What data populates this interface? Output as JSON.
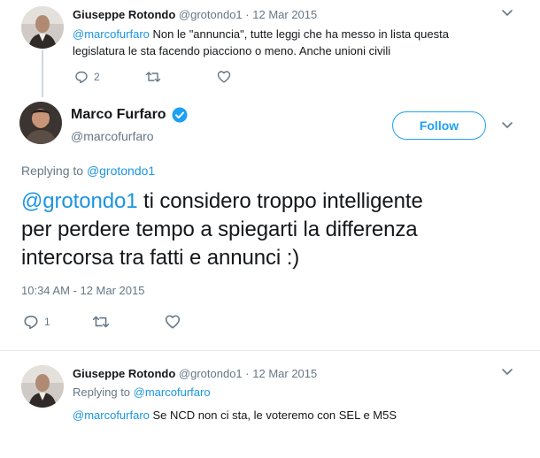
{
  "tweet1": {
    "name": "Giuseppe Rotondo",
    "handle": "@grotondo1",
    "sep": "·",
    "date": "12 Mar 2015",
    "mention": "@marcofurfaro",
    "text_line1": " Non le \"annuncia\", tutte leggi che ha messo in lista questa",
    "text_line2": "legislatura le sta facendo piacciono o meno. Anche unioni civili",
    "reply_count": "2",
    "avatar_icon": "avatar-photo",
    "caret_icon": "chevron-down-icon"
  },
  "main": {
    "name": "Marco Furfaro",
    "handle": "@marcofurfaro",
    "verified_icon": "verified-badge-icon",
    "follow_label": "Follow",
    "replying_prefix": "Replying to ",
    "replying_handle": "@grotondo1",
    "mention": "@grotondo1",
    "text_line1": " ti considero troppo intelligente",
    "text_line2": "per perdere tempo a spiegarti la differenza",
    "text_line3": "intercorsa tra fatti e annunci :)",
    "timestamp": "10:34 AM - 12 Mar 2015",
    "reply_count": "1"
  },
  "tweet3": {
    "name": "Giuseppe Rotondo",
    "handle": "@grotondo1",
    "sep": "·",
    "date": "12 Mar 2015",
    "replying_prefix": "Replying to ",
    "replying_handle": "@marcofurfaro",
    "mention": "@marcofurfaro",
    "text": " Se NCD non ci sta, le voteremo con SEL e M5S"
  },
  "colors": {
    "link": "#1b95e0",
    "muted": "#657786",
    "divider": "#e6ecf0",
    "verified": "#1da1f2"
  }
}
